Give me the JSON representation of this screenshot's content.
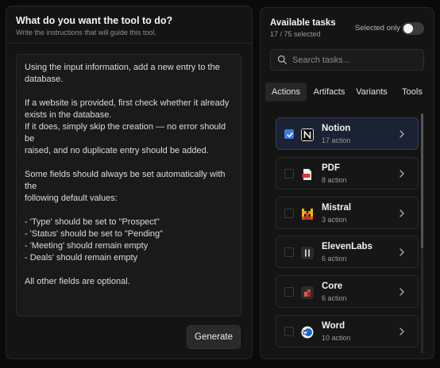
{
  "left_panel": {
    "title": "What do you want the tool to do?",
    "subtitle": "Write the instructions that will guide this tool.",
    "instructions": [
      "Using the input information, add a new entry to the",
      "database.",
      "",
      "If a website is provided, first check whether it already",
      "exists in the database.",
      "If it does, simply skip the creation — no error should be",
      "raised, and no duplicate entry should be added.",
      "",
      "Some fields should always be set automatically with the",
      "following default values:",
      "",
      "- 'Type' should be set to \"Prospect\"",
      "- 'Status' should be set to \"Pending\"",
      "- 'Meeting' should remain empty",
      "- Deals' should remain empty",
      "",
      "All other fields are optional."
    ],
    "generate_label": "Generate"
  },
  "right_panel": {
    "title": "Available tasks",
    "count": "17 / 75 selected",
    "selected_only_label": "Selected only",
    "selected_only_on": false,
    "search_placeholder": "Search tasks...",
    "tabs": [
      {
        "label": "Actions",
        "active": true
      },
      {
        "label": "Artifacts",
        "active": false
      },
      {
        "label": "Variants",
        "active": false
      },
      {
        "label": "Tools",
        "active": false
      }
    ],
    "tasks": [
      {
        "name": "Notion",
        "count": "17 action",
        "checked": true,
        "icon": "notion-icon"
      },
      {
        "name": "PDF",
        "count": "8 action",
        "checked": false,
        "icon": "pdf-icon"
      },
      {
        "name": "Mistral",
        "count": "3 action",
        "checked": false,
        "icon": "mistral-icon"
      },
      {
        "name": "ElevenLabs",
        "count": "6 action",
        "checked": false,
        "icon": "elevenlabs-icon"
      },
      {
        "name": "Core",
        "count": "6 action",
        "checked": false,
        "icon": "core-icon"
      },
      {
        "name": "Word",
        "count": "10 action",
        "checked": false,
        "icon": "word-icon"
      }
    ]
  },
  "colors": {
    "background": "#0a0a0a",
    "panel": "#141414",
    "accent_blue": "#3d7ae6"
  }
}
